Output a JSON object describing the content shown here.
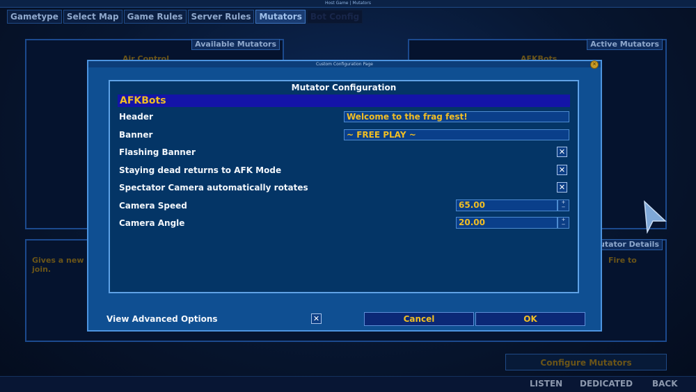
{
  "window_title": "Host Game | Mutators",
  "tabs": [
    {
      "label": "Gametype"
    },
    {
      "label": "Select Map"
    },
    {
      "label": "Game Rules"
    },
    {
      "label": "Server Rules"
    },
    {
      "label": "Mutators"
    },
    {
      "label": "Bot Config"
    }
  ],
  "available_panel": {
    "title": "Available Mutators",
    "first_item": "Air Control"
  },
  "active_panel": {
    "title": "Active Mutators",
    "first_item": "AFKBots"
  },
  "details_panel": {
    "title": "Mutator Details",
    "description_left": "Gives a new",
    "description_left_2": "join.",
    "description_right": "Fire to"
  },
  "configure_button": "Configure Mutators",
  "footer": {
    "listen": "LISTEN",
    "dedicated": "DEDICATED",
    "back": "BACK"
  },
  "modal": {
    "title": "Custom Configuration Page",
    "inner_title": "Mutator Configuration",
    "mutator_name": "AFKBots",
    "rows": {
      "header_label": "Header",
      "header_value": "Welcome to the frag fest!",
      "banner_label": "Banner",
      "banner_value": "~ FREE  PLAY ~",
      "flashing_label": "Flashing Banner",
      "afk_label": "Staying dead returns to AFK Mode",
      "spectator_label": "Spectator Camera automatically rotates",
      "speed_label": "Camera Speed",
      "speed_value": "65.00",
      "angle_label": "Camera Angle",
      "angle_value": "20.00"
    },
    "advanced_label": "View Advanced Options",
    "cancel": "Cancel",
    "ok": "OK",
    "check_glyph": "✕"
  }
}
